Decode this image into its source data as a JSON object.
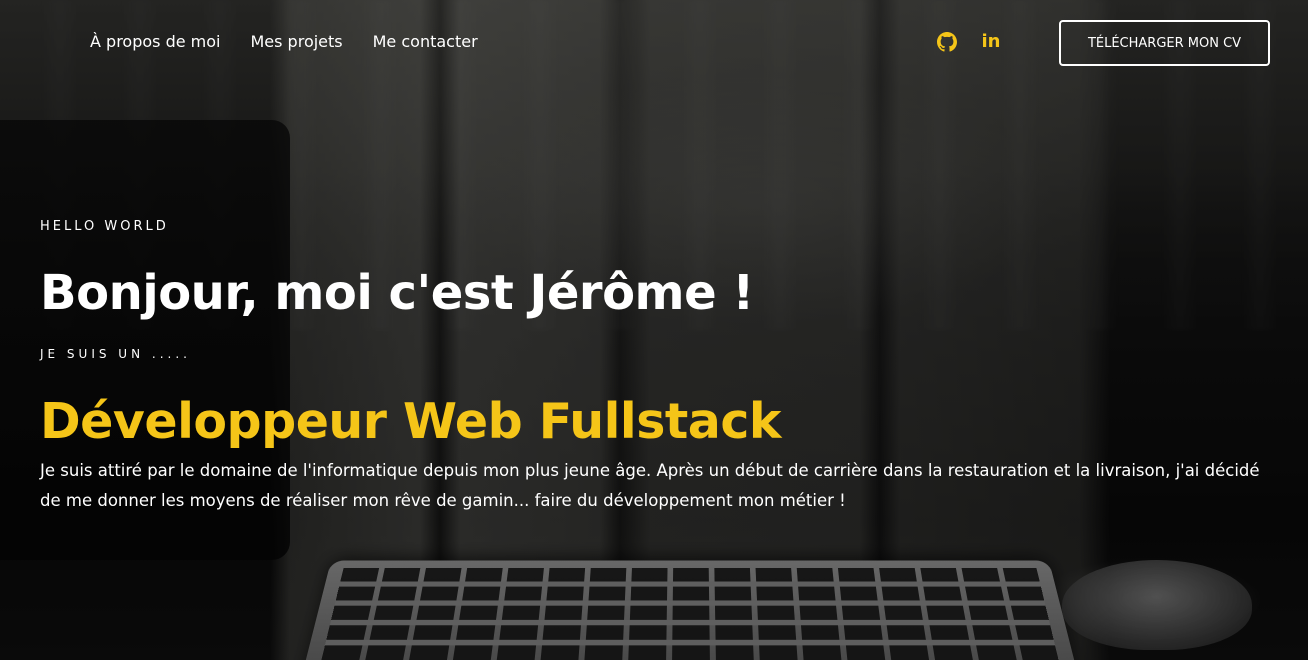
{
  "nav": {
    "links": [
      {
        "label": "À propos de moi"
      },
      {
        "label": "Mes projets"
      },
      {
        "label": "Me contacter"
      }
    ],
    "socials": [
      {
        "icon": "github-icon"
      },
      {
        "icon": "linkedin-icon",
        "label": "in"
      }
    ],
    "cv_button": "TÉLÉCHARGER MON CV"
  },
  "hero": {
    "eyebrow": "HELLO WORLD",
    "title": "Bonjour, moi c'est Jérôme !",
    "subtitle": "JE SUIS UN .....",
    "role": "Développeur Web Fullstack",
    "intro": "Je suis attiré par le domaine de l'informatique depuis mon plus jeune âge. Après un début de carrière dans la restauration et la livraison, j'ai décidé de me donner les moyens de réaliser mon rêve de gamin... faire du développement mon métier !"
  },
  "colors": {
    "accent": "#f5c518",
    "text": "#ffffff",
    "background": "#0b0b0b"
  }
}
